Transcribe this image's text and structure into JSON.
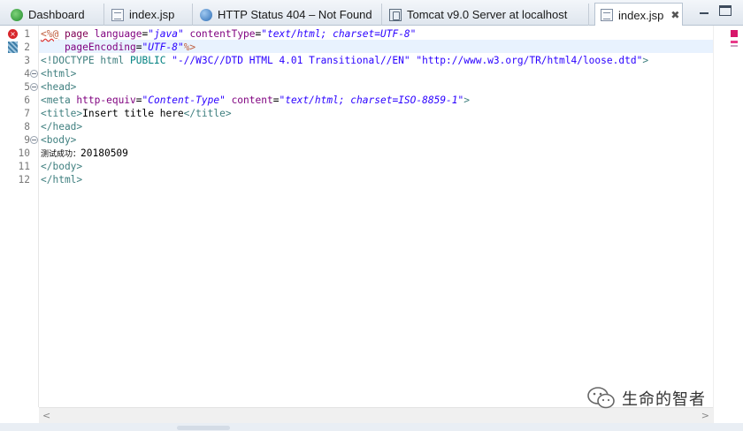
{
  "tabs": [
    {
      "label": "Dashboard",
      "icon": "dashboard-icon",
      "active": false
    },
    {
      "label": "index.jsp",
      "icon": "jsp-file-icon",
      "active": false
    },
    {
      "label": "HTTP Status 404 – Not Found",
      "icon": "globe-icon",
      "active": false
    },
    {
      "label": "Tomcat v9.0 Server at localhost",
      "icon": "server-icon",
      "active": false
    },
    {
      "label": "index.jsp",
      "icon": "jsp-file-icon",
      "active": true,
      "close": "✖"
    }
  ],
  "window_controls": {
    "minimize": "minimize-icon",
    "maximize": "maximize-icon"
  },
  "editor": {
    "line_numbers": [
      "1",
      "2",
      "3",
      "4",
      "5",
      "6",
      "7",
      "8",
      "9",
      "10",
      "11",
      "12"
    ],
    "lines": [
      {
        "segments": [
          {
            "t": "<%@",
            "c": "t-jsperr"
          },
          {
            "t": " page ",
            "c": "t-kw"
          },
          {
            "t": "language",
            "c": "t-attr"
          },
          {
            "t": "=",
            "c": "t-text"
          },
          {
            "t": "\"java\"",
            "c": "t-str"
          },
          {
            "t": " contentType",
            "c": "t-attr"
          },
          {
            "t": "=",
            "c": "t-text"
          },
          {
            "t": "\"text/html; charset=UTF-8\"",
            "c": "t-str"
          }
        ]
      },
      {
        "segments": [
          {
            "t": "    pageEncoding",
            "c": "t-attr"
          },
          {
            "t": "=",
            "c": "t-text"
          },
          {
            "t": "\"UTF-8\"",
            "c": "t-str"
          },
          {
            "t": "%>",
            "c": "t-jsp"
          }
        ]
      },
      {
        "segments": [
          {
            "t": "<!DOCTYPE html ",
            "c": "t-tag"
          },
          {
            "t": "PUBLIC ",
            "c": "t-dt"
          },
          {
            "t": "\"-//W3C//DTD HTML 4.01 Transitional//EN\" \"http://www.w3.org/TR/html4/loose.dtd\"",
            "c": "t-strn"
          },
          {
            "t": ">",
            "c": "t-tag"
          }
        ]
      },
      {
        "segments": [
          {
            "t": "<html>",
            "c": "t-tag"
          }
        ]
      },
      {
        "segments": [
          {
            "t": "<head>",
            "c": "t-tag"
          }
        ]
      },
      {
        "segments": [
          {
            "t": "<meta ",
            "c": "t-tag"
          },
          {
            "t": "http-equiv",
            "c": "t-attr"
          },
          {
            "t": "=",
            "c": "t-text"
          },
          {
            "t": "\"Content-Type\"",
            "c": "t-str"
          },
          {
            "t": " content",
            "c": "t-attr"
          },
          {
            "t": "=",
            "c": "t-text"
          },
          {
            "t": "\"text/html; charset=ISO-8859-1\"",
            "c": "t-str"
          },
          {
            "t": ">",
            "c": "t-tag"
          }
        ]
      },
      {
        "segments": [
          {
            "t": "<title>",
            "c": "t-tag"
          },
          {
            "t": "Insert title here",
            "c": "t-text"
          },
          {
            "t": "</title>",
            "c": "t-tag"
          }
        ]
      },
      {
        "segments": [
          {
            "t": "</head>",
            "c": "t-tag"
          }
        ]
      },
      {
        "segments": [
          {
            "t": "<body>",
            "c": "t-tag"
          }
        ]
      },
      {
        "segments": [
          {
            "t": "测试成功：",
            "c": "t-text",
            "small": true
          },
          {
            "t": "20180509",
            "c": "t-text"
          }
        ]
      },
      {
        "segments": [
          {
            "t": "</body>",
            "c": "t-tag"
          }
        ]
      },
      {
        "segments": [
          {
            "t": "</html>",
            "c": "t-tag"
          }
        ]
      }
    ],
    "fold_lines": [
      4,
      5,
      9
    ],
    "error_marker_line": 1,
    "change_marker_line": 2,
    "highlighted_line": 2
  },
  "scrollbar": {
    "left": "<",
    "right": ">"
  },
  "watermark": {
    "text": "生命的智者"
  },
  "colors": {
    "tag": "#3f7f7f",
    "keyword": "#7f0055",
    "attribute": "#7f007f",
    "string": "#2a00ff",
    "error": "#d8262b"
  }
}
